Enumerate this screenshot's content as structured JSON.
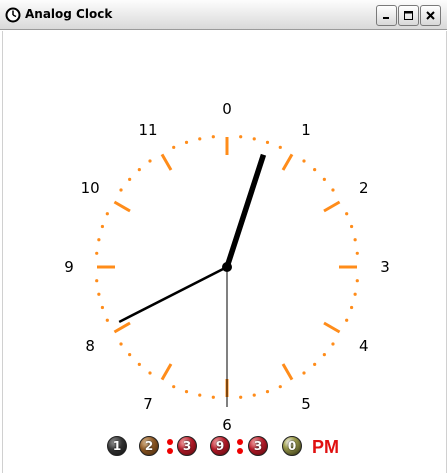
{
  "window": {
    "title": "Analog Clock",
    "controls": {
      "minimize": "minimize",
      "maximize": "maximize",
      "close": "close"
    }
  },
  "clock": {
    "numbers": [
      "0",
      "1",
      "2",
      "3",
      "4",
      "5",
      "6",
      "7",
      "8",
      "9",
      "10",
      "11"
    ],
    "hour_value": 0.6,
    "minute_value": 40.5,
    "second_value": 30,
    "colors": {
      "ticks": "#ff8c1a",
      "hands": "#000000",
      "numbers": "#000000"
    }
  },
  "digital": {
    "hour_digits": [
      "1",
      "2"
    ],
    "minute_digits": [
      "3",
      "9"
    ],
    "second_digits": [
      "3",
      "0"
    ],
    "ampm": "PM",
    "colors": {
      "colon": "#ee0000",
      "ampm": "#e01010"
    }
  }
}
